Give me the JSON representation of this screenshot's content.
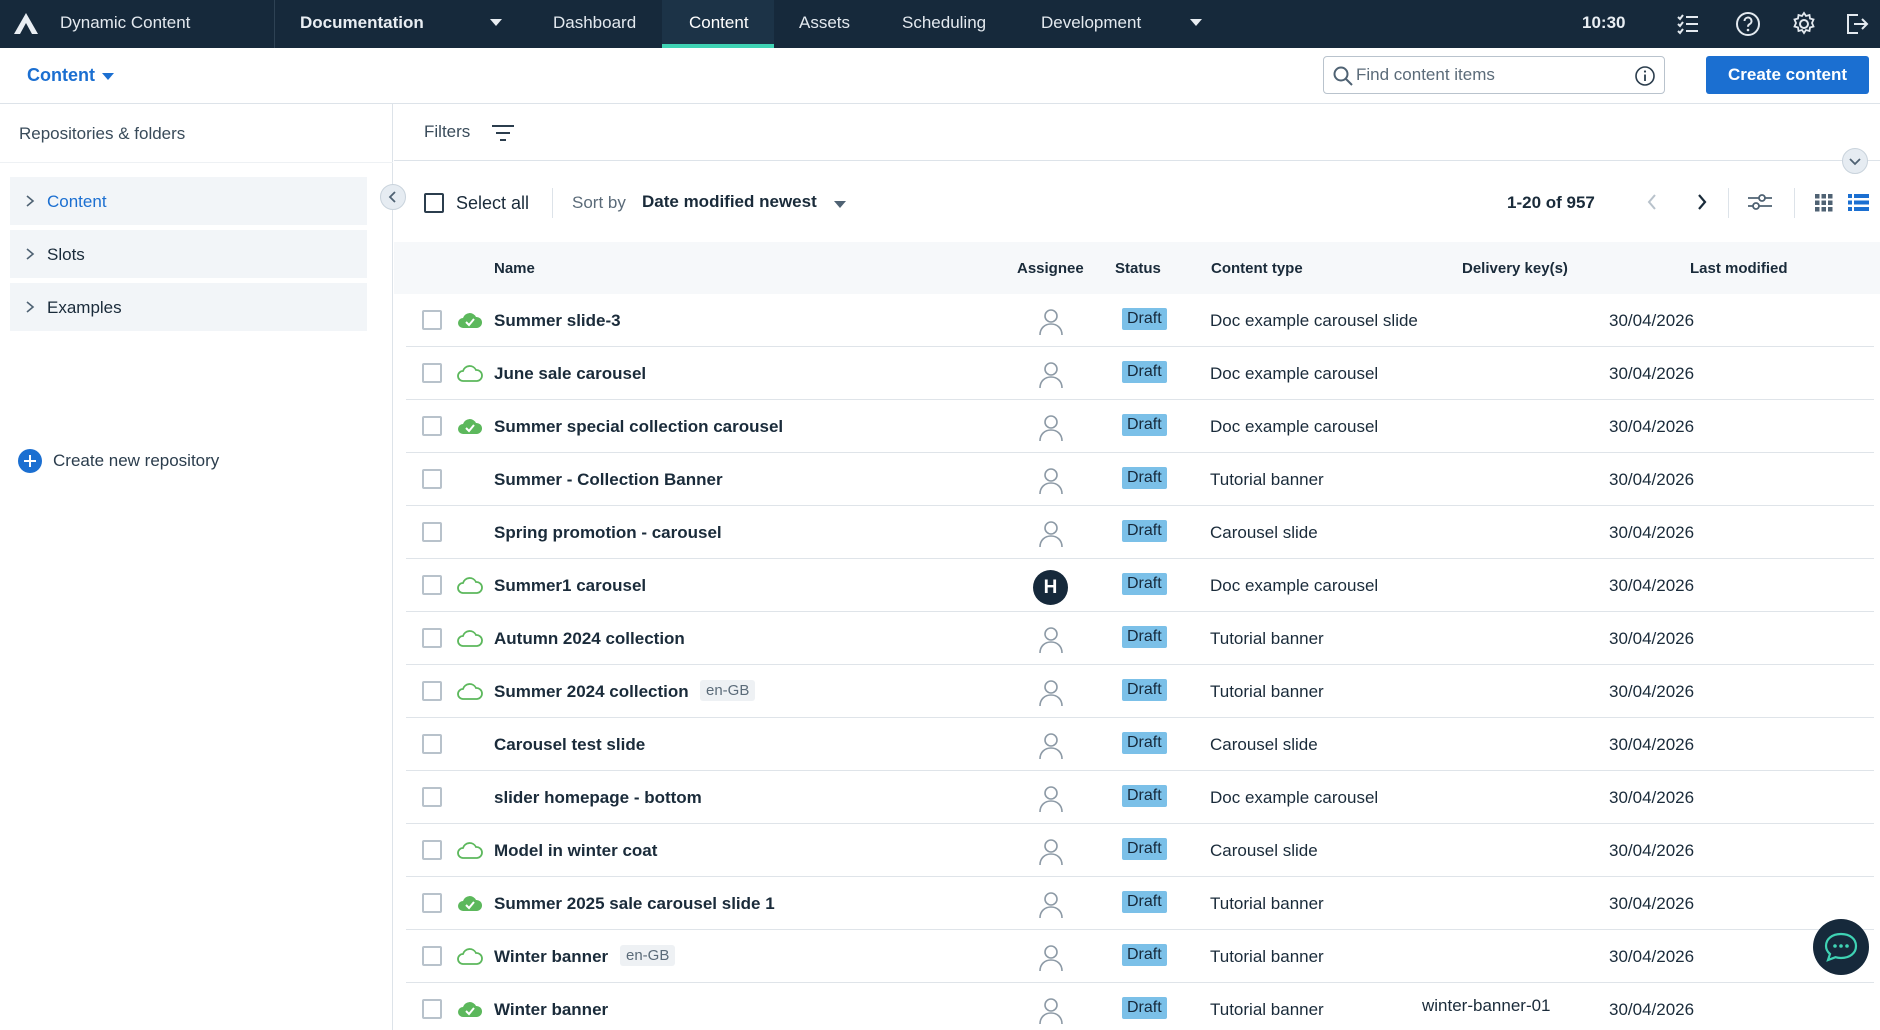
{
  "topbar": {
    "app_name": "Dynamic Content",
    "hub": "Documentation",
    "nav": [
      "Dashboard",
      "Content",
      "Assets",
      "Scheduling",
      "Development"
    ],
    "active_nav": "Content",
    "time": "10:30"
  },
  "subbar": {
    "context": "Content",
    "search_placeholder": "Find content items",
    "create_label": "Create content"
  },
  "sidebar": {
    "title": "Repositories & folders",
    "repos": [
      "Content",
      "Slots",
      "Examples"
    ],
    "create_label": "Create new repository"
  },
  "filters": {
    "label": "Filters"
  },
  "toolbar": {
    "select_all": "Select all",
    "sort_label": "Sort by",
    "sort_value": "Date modified newest",
    "range": "1-20 of 957"
  },
  "table": {
    "headers": [
      "Name",
      "Assignee",
      "Status",
      "Content type",
      "Delivery key(s)",
      "Last modified"
    ],
    "rows": [
      {
        "name": "Summer slide-3",
        "cloud": "filled",
        "locale": "",
        "assignee": "",
        "status": "Draft",
        "type": "Doc example carousel slide",
        "key": "",
        "modified": "30/04/2026"
      },
      {
        "name": "June sale carousel",
        "cloud": "outline",
        "locale": "",
        "assignee": "",
        "status": "Draft",
        "type": "Doc example carousel",
        "key": "",
        "modified": "30/04/2026"
      },
      {
        "name": "Summer special collection carousel",
        "cloud": "filled",
        "locale": "",
        "assignee": "",
        "status": "Draft",
        "type": "Doc example carousel",
        "key": "",
        "modified": "30/04/2026"
      },
      {
        "name": "Summer - Collection Banner",
        "cloud": "none",
        "locale": "",
        "assignee": "",
        "status": "Draft",
        "type": "Tutorial banner",
        "key": "",
        "modified": "30/04/2026"
      },
      {
        "name": "Spring promotion - carousel",
        "cloud": "none",
        "locale": "",
        "assignee": "",
        "status": "Draft",
        "type": "Carousel slide",
        "key": "",
        "modified": "30/04/2026"
      },
      {
        "name": "Summer1 carousel",
        "cloud": "outline",
        "locale": "",
        "assignee": "H",
        "status": "Draft",
        "type": "Doc example carousel",
        "key": "",
        "modified": "30/04/2026"
      },
      {
        "name": "Autumn 2024 collection",
        "cloud": "outline",
        "locale": "",
        "assignee": "",
        "status": "Draft",
        "type": "Tutorial banner",
        "key": "",
        "modified": "30/04/2026"
      },
      {
        "name": "Summer 2024 collection",
        "cloud": "outline",
        "locale": "en-GB",
        "assignee": "",
        "status": "Draft",
        "type": "Tutorial banner",
        "key": "",
        "modified": "30/04/2026"
      },
      {
        "name": "Carousel test slide",
        "cloud": "none",
        "locale": "",
        "assignee": "",
        "status": "Draft",
        "type": "Carousel slide",
        "key": "",
        "modified": "30/04/2026"
      },
      {
        "name": "slider homepage - bottom",
        "cloud": "none",
        "locale": "",
        "assignee": "",
        "status": "Draft",
        "type": "Doc example carousel",
        "key": "",
        "modified": "30/04/2026"
      },
      {
        "name": "Model in winter coat",
        "cloud": "outline",
        "locale": "",
        "assignee": "",
        "status": "Draft",
        "type": "Carousel slide",
        "key": "",
        "modified": "30/04/2026"
      },
      {
        "name": "Summer 2025 sale carousel slide 1",
        "cloud": "filled",
        "locale": "",
        "assignee": "",
        "status": "Draft",
        "type": "Tutorial banner",
        "key": "",
        "modified": "30/04/2026"
      },
      {
        "name": "Winter banner",
        "cloud": "outline",
        "locale": "en-GB",
        "assignee": "",
        "status": "Draft",
        "type": "Tutorial banner",
        "key": "",
        "modified": "30/04/2026"
      },
      {
        "name": "Winter banner",
        "cloud": "filled",
        "locale": "",
        "assignee": "",
        "status": "Draft",
        "type": "Tutorial banner",
        "key": "winter-banner-01",
        "modified": "30/04/2026"
      }
    ]
  },
  "colors": {
    "topbar": "#16293b",
    "accent": "#1b6fd1",
    "active_tab": "#3fd3b4",
    "draft_badge": "#7bc0e8",
    "cloud_green": "#5cb85c"
  },
  "icons": {
    "logo": "amplience-logo-icon",
    "tasks": "task-list-icon",
    "help": "help-icon",
    "settings": "gear-icon",
    "logout": "logout-icon",
    "chat": "chat-icon"
  }
}
